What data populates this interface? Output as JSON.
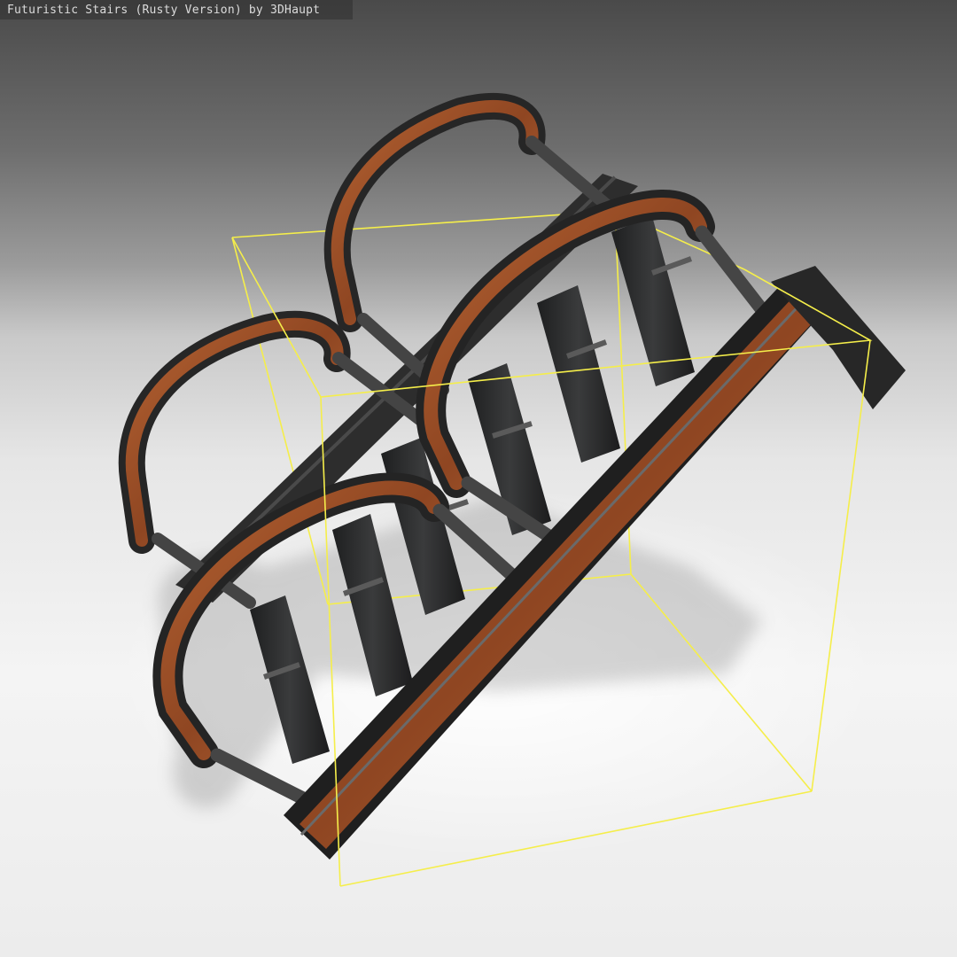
{
  "viewer": {
    "title": "Futuristic Stairs (Rusty Version) by 3DHaupt",
    "model_name": "futuristic-stairs-rusty",
    "bounding_box_color": "#f5ee4a",
    "rust_color": "#a5552c",
    "metal_color": "#2b2b2b",
    "step_color": "#262728"
  }
}
